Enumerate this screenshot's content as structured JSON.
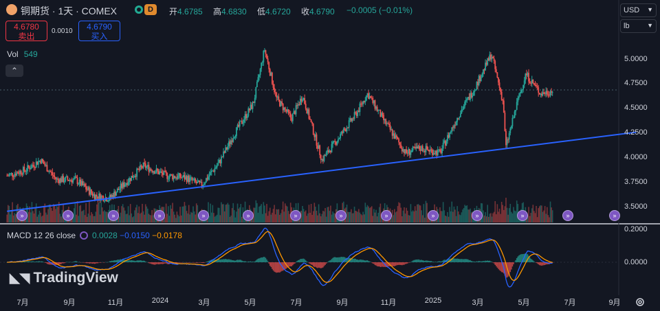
{
  "header": {
    "title": "铜期货 · 1天 · COMEX",
    "interval_badge": "D",
    "ohlc": [
      {
        "k": "开",
        "v": "4.6785"
      },
      {
        "k": "高",
        "v": "4.6830"
      },
      {
        "k": "低",
        "v": "4.6720"
      },
      {
        "k": "收",
        "v": "4.6790"
      }
    ],
    "change": "−0.0005 (−0.01%)"
  },
  "trade": {
    "sell_price": "4.6780",
    "sell_label": "卖出",
    "spread": "0.0010",
    "buy_price": "4.6790",
    "buy_label": "买入"
  },
  "volume": {
    "label": "Vol",
    "value": "549"
  },
  "selectors": {
    "currency": "USD",
    "unit": "lb"
  },
  "price_axis": [
    "5.0000",
    "4.7500",
    "4.5000",
    "4.2500",
    "4.0000",
    "3.7500",
    "3.5000"
  ],
  "macd_axis": [
    "0.2000",
    "0.0000"
  ],
  "time_axis": [
    "7月",
    "9月",
    "11月",
    "2024",
    "3月",
    "5月",
    "7月",
    "9月",
    "11月",
    "2025",
    "3月",
    "5月",
    "7月",
    "9月"
  ],
  "macd": {
    "label": "MACD 12 26 close",
    "macd": "0.0028",
    "signal": "−0.0150",
    "hist": "−0.0178"
  },
  "watermark": "TradingView",
  "colors": {
    "up": "#26a69a",
    "down": "#ef5350",
    "trendline": "#2962ff",
    "macd_line": "#2962ff",
    "signal_line": "#ff9800",
    "event": "#7e57c2"
  },
  "chart_data": {
    "type": "candlestick",
    "title": "铜期货 · 1天 · COMEX",
    "ylim": [
      3.42,
      5.3
    ],
    "x_range": [
      "2023-07",
      "2025-09"
    ],
    "close_path": [
      [
        "2023-06-10",
        3.82
      ],
      [
        "2023-07-05",
        3.88
      ],
      [
        "2023-07-25",
        3.98
      ],
      [
        "2023-08-15",
        3.78
      ],
      [
        "2023-09-10",
        3.78
      ],
      [
        "2023-10-05",
        3.62
      ],
      [
        "2023-10-25",
        3.59
      ],
      [
        "2023-11-20",
        3.78
      ],
      [
        "2023-12-10",
        3.92
      ],
      [
        "2024-01-10",
        3.82
      ],
      [
        "2024-02-05",
        3.8
      ],
      [
        "2024-02-25",
        3.72
      ],
      [
        "2024-03-20",
        3.95
      ],
      [
        "2024-04-10",
        4.25
      ],
      [
        "2024-05-05",
        4.55
      ],
      [
        "2024-05-20",
        5.1
      ],
      [
        "2024-06-05",
        4.6
      ],
      [
        "2024-06-25",
        4.4
      ],
      [
        "2024-07-10",
        4.63
      ],
      [
        "2024-08-05",
        3.98
      ],
      [
        "2024-08-25",
        4.18
      ],
      [
        "2024-09-20",
        4.45
      ],
      [
        "2024-10-05",
        4.65
      ],
      [
        "2024-10-25",
        4.4
      ],
      [
        "2024-11-25",
        4.05
      ],
      [
        "2024-12-15",
        4.1
      ],
      [
        "2025-01-10",
        4.05
      ],
      [
        "2025-02-05",
        4.45
      ],
      [
        "2025-02-25",
        4.7
      ],
      [
        "2025-03-20",
        5.05
      ],
      [
        "2025-04-05",
        4.55
      ],
      [
        "2025-04-08",
        4.1
      ],
      [
        "2025-04-25",
        4.6
      ],
      [
        "2025-05-05",
        4.85
      ],
      [
        "2025-05-25",
        4.65
      ],
      [
        "2025-06-10",
        4.68
      ]
    ],
    "trendline": {
      "start": [
        "2023-06-10",
        3.46
      ],
      "end": [
        "2025-09-30",
        4.26
      ]
    },
    "current_price": 4.679
  }
}
